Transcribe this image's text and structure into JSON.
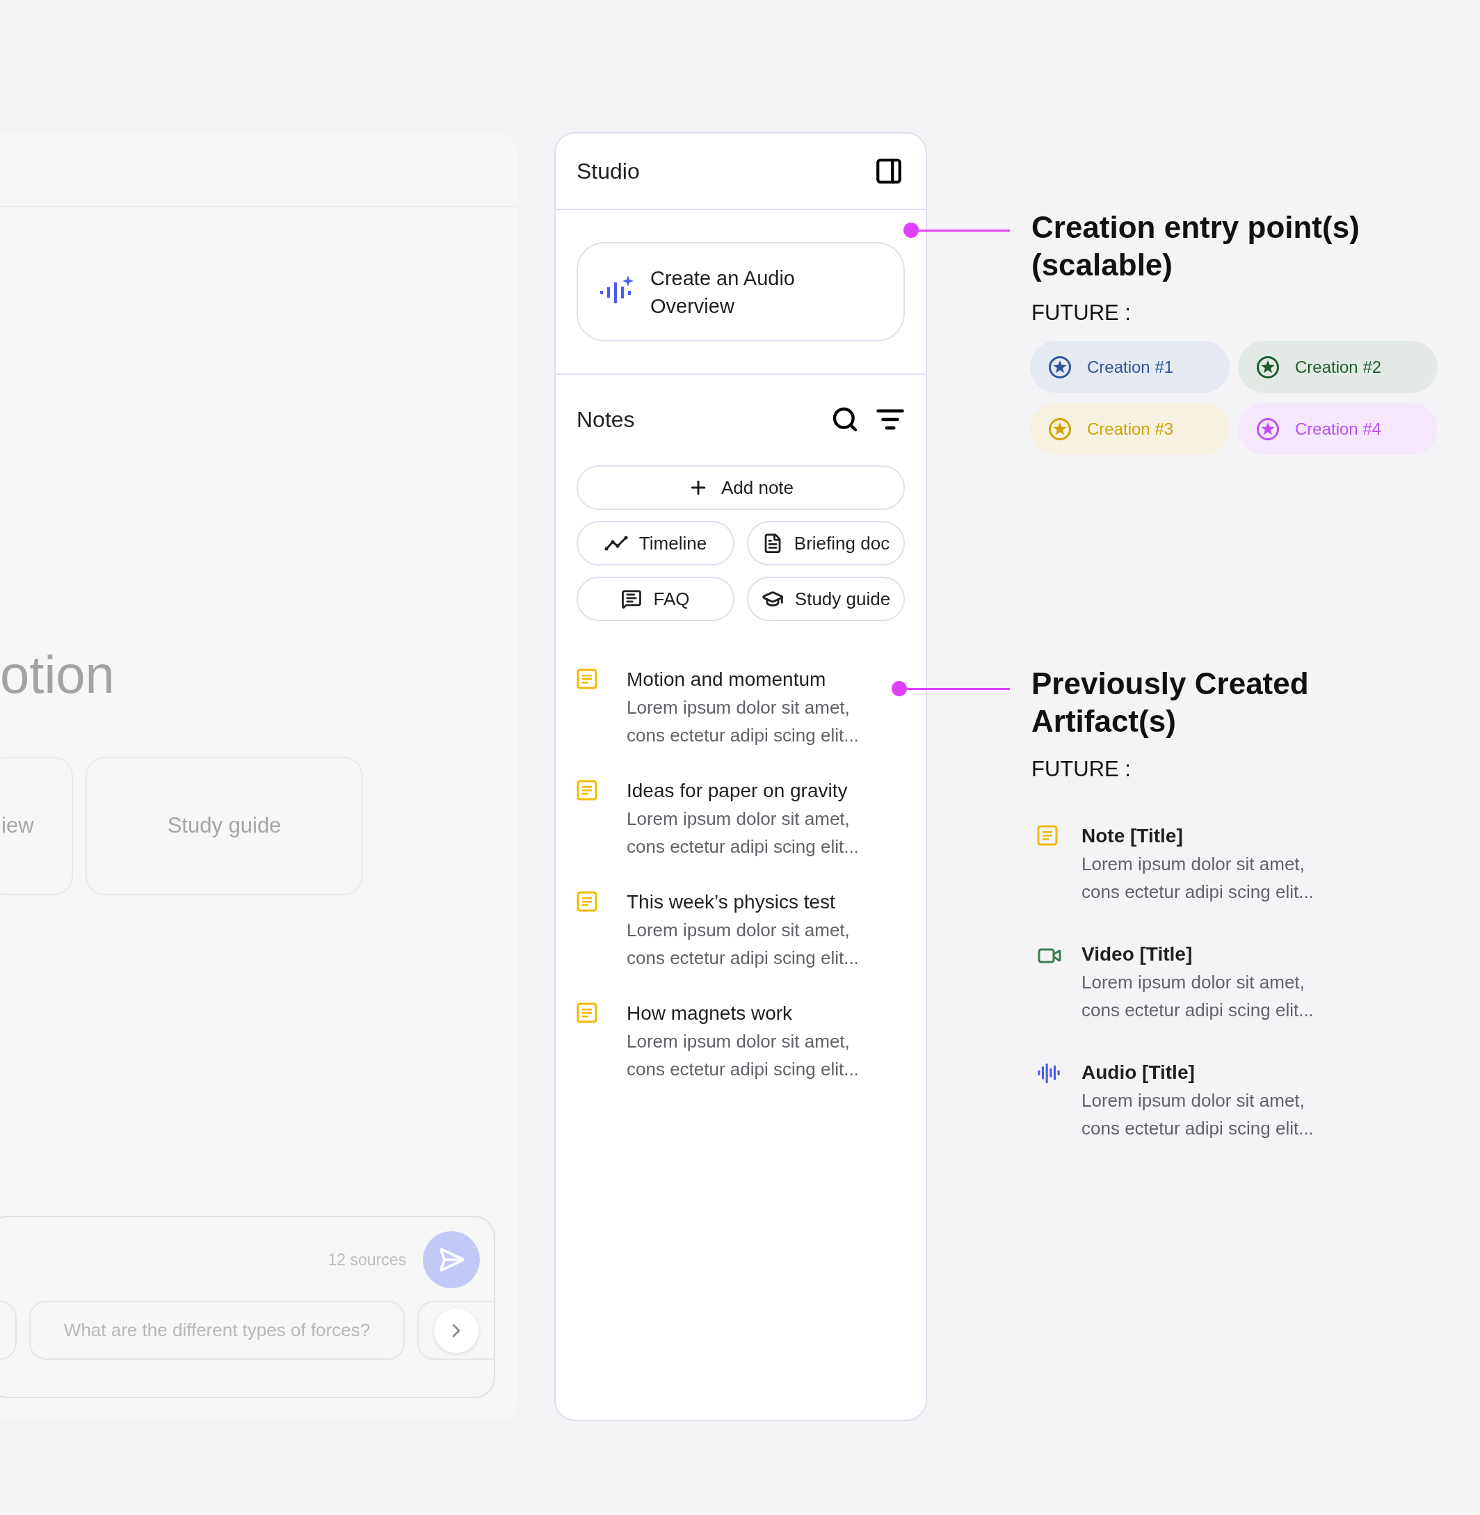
{
  "background_panel": {
    "heading": "otion",
    "cards": [
      {
        "label": "iew"
      },
      {
        "label": "Study guide"
      }
    ],
    "composer": {
      "source_count": "12 sources",
      "suggestion": "What are the different types of forces?"
    }
  },
  "studio": {
    "title": "Studio",
    "audio_overview": "Create an Audio Overview",
    "notes": {
      "title": "Notes",
      "add_button": "Add note",
      "actions": [
        {
          "kind": "timeline",
          "label": "Timeline"
        },
        {
          "kind": "briefing",
          "label": "Briefing doc"
        },
        {
          "kind": "faq",
          "label": "FAQ"
        },
        {
          "kind": "study",
          "label": "Study guide"
        }
      ],
      "items": [
        {
          "title": "Motion and momentum",
          "body": "Lorem ipsum dolor sit amet,\ncons ectetur adipi scing elit..."
        },
        {
          "title": "Ideas for paper on gravity",
          "body": "Lorem ipsum dolor sit amet,\ncons ectetur adipi scing elit..."
        },
        {
          "title": "This week’s physics test",
          "body": "Lorem ipsum dolor sit amet,\ncons ectetur adipi scing elit..."
        },
        {
          "title": "How magnets work",
          "body": "Lorem ipsum dolor sit amet,\ncons ectetur adipi scing elit..."
        }
      ]
    }
  },
  "annotations": [
    {
      "title": "Creation entry point(s) (scalable)",
      "subtitle": "FUTURE :",
      "chips": [
        {
          "label": "Creation #1",
          "color": "#2f5597"
        },
        {
          "label": "Creation #2",
          "color": "#1e5c2e"
        },
        {
          "label": "Creation #3",
          "color": "#d4a000"
        },
        {
          "label": "Creation #4",
          "color": "#c04ef0"
        }
      ]
    },
    {
      "title": "Previously Created Artifact(s)",
      "subtitle": "FUTURE :",
      "artifacts": [
        {
          "kind": "note",
          "title": "Note [Title]",
          "body": "Lorem ipsum dolor sit amet,\ncons ectetur adipi scing elit..."
        },
        {
          "kind": "video",
          "title": "Video [Title]",
          "body": "Lorem ipsum dolor sit amet,\ncons ectetur adipi scing elit..."
        },
        {
          "kind": "audio",
          "title": "Audio [Title]",
          "body": "Lorem ipsum dolor sit amet,\ncons ectetur adipi scing elit..."
        }
      ]
    }
  ]
}
